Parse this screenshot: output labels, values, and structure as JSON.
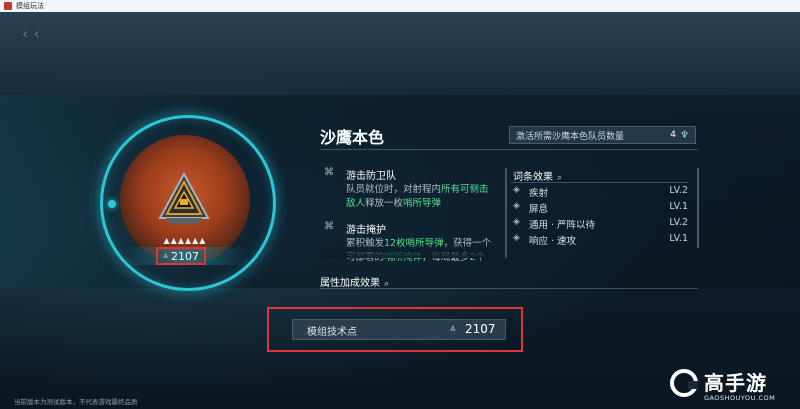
{
  "window": {
    "title": "模组玩法"
  },
  "module": {
    "name": "沙鹰本色",
    "stars": "▲▲▲▲▲▲",
    "points": "2107",
    "requirement_label": "激活所需沙鹰本色队员数量",
    "requirement_count": "4"
  },
  "skills": [
    {
      "name": "游击防卫队",
      "line1_pre": "队员就位时，对射程内",
      "line1_hl": "所有可侧击",
      "line2_hl": "敌人",
      "line2_mid": "释放一枚",
      "line2_hl2": "哨所导弹"
    },
    {
      "name": "游击掩护",
      "line1_pre": "累积触发",
      "line1_hl": "12枚哨所导弹",
      "line1_post": "，获得一个",
      "line2_pre": "可部署的",
      "line2_hl": "哨所掩体",
      "line2_post": "，每局最多",
      "line2_hl2": "2个"
    }
  ],
  "terms": {
    "title": "词条效果",
    "items": [
      {
        "label": "疾射",
        "level": "LV.2"
      },
      {
        "label": "屏息",
        "level": "LV.1"
      },
      {
        "label": "通用 · 严阵以待",
        "level": "LV.2"
      },
      {
        "label": "响应 · 速攻",
        "level": "LV.1"
      }
    ]
  },
  "attributes": {
    "title": "属性加成效果"
  },
  "tech": {
    "label": "模组技术点",
    "value": "2107"
  },
  "disclaimer": "当前版本为测试版本，不代表游戏最终品质",
  "watermark": {
    "text": "高手游",
    "sub": "GAOSHOUYOU.COM"
  },
  "colors": {
    "accent": "#2cc6d6",
    "highlight": "#4fe08d",
    "annotation": "#e0343a"
  }
}
